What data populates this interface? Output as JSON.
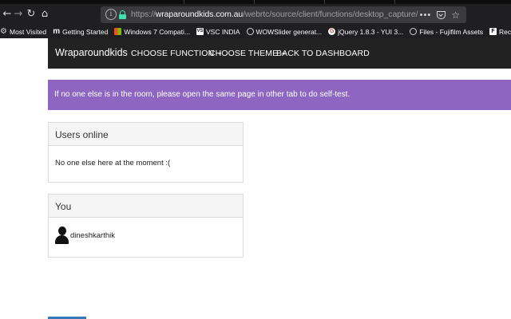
{
  "browser": {
    "url_prefix": "https://",
    "url_host": "wraparoundkids.com.au",
    "url_path": "/webrtc/source/client/functions/desktop_capture/",
    "nav_back": "←",
    "nav_forward": "→",
    "nav_reload": "↻",
    "nav_home": "⌂",
    "url_info": "i",
    "page_actions": "•••",
    "bookmark_star": "☆",
    "bookmarks": [
      {
        "label": "Most Visited",
        "icon": "gear-icon",
        "glyph": "⚙"
      },
      {
        "label": "Getting Started",
        "icon": "m-logo-icon",
        "glyph": "m"
      },
      {
        "label": "Windows 7 Compati...",
        "icon": "windows-logo-icon",
        "glyph": ""
      },
      {
        "label": "VSC INDIA",
        "icon": "vsc-logo-icon",
        "glyph": "VS"
      },
      {
        "label": "WOWSlider generat...",
        "icon": "globe-icon",
        "glyph": ""
      },
      {
        "label": "jQuery 1.8.3 - YUI 3...",
        "icon": "google-icon",
        "glyph": "G"
      },
      {
        "label": "Files - Fujifilm Assets",
        "icon": "globe-icon",
        "glyph": ""
      },
      {
        "label": "Receipt",
        "icon": "f-logo-icon",
        "glyph": "F"
      }
    ]
  },
  "site": {
    "brand": "Wraparoundkids",
    "nav": {
      "choose_function": "CHOOSE FUNCTION",
      "choose_theme": "CHOOSE THEME",
      "back_to_dashboard": "BACK TO DASHBOARD"
    },
    "alert": "If no one else is in the room, please open the same page in other tab to do self-test.",
    "users_panel": {
      "title": "Users online",
      "empty_message": "No one else here at the moment :("
    },
    "you_panel": {
      "title": "You",
      "username": "dineshkarthik"
    }
  },
  "colors": {
    "navbar": "#222222",
    "alert": "#8e66c1",
    "lock": "#3fe1b0"
  }
}
